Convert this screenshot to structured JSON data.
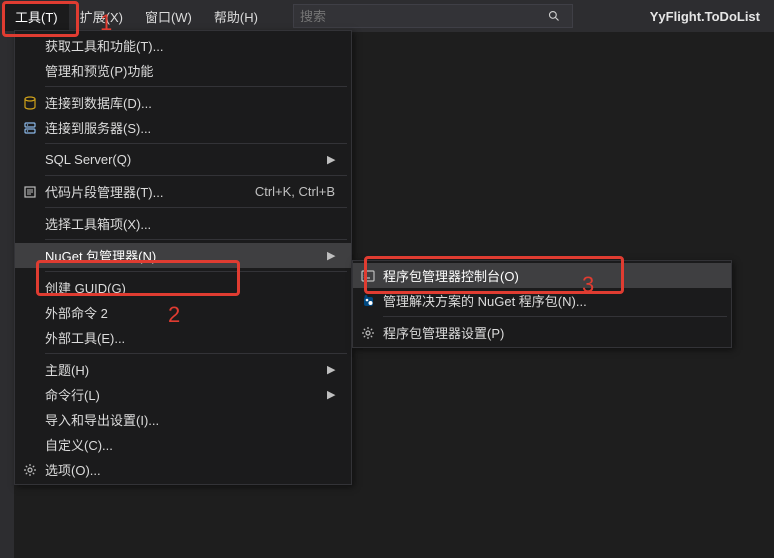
{
  "menubar": {
    "tools": "工具(T)",
    "extensions": "扩展(X)",
    "window": "窗口(W)",
    "help": "帮助(H)"
  },
  "search": {
    "placeholder": "搜索"
  },
  "solution_name": "YyFlight.ToDoList",
  "annotations": {
    "one": "1",
    "two": "2",
    "three": "3"
  },
  "tools_menu": [
    {
      "id": "get-tools",
      "label": "获取工具和功能(T)...",
      "icon": null
    },
    {
      "id": "manage-preview",
      "label": "管理和预览(P)功能",
      "icon": null
    },
    {
      "sep": true
    },
    {
      "id": "connect-db",
      "label": "连接到数据库(D)...",
      "icon": "database"
    },
    {
      "id": "connect-server",
      "label": "连接到服务器(S)...",
      "icon": "server"
    },
    {
      "sep": true
    },
    {
      "id": "sql-server",
      "label": "SQL Server(Q)",
      "icon": null,
      "submenu": true
    },
    {
      "sep": true
    },
    {
      "id": "snippet-mgr",
      "label": "代码片段管理器(T)...",
      "icon": "snippet",
      "shortcut": "Ctrl+K, Ctrl+B"
    },
    {
      "sep": true
    },
    {
      "id": "toolbox",
      "label": "选择工具箱项(X)...",
      "icon": null
    },
    {
      "sep": true
    },
    {
      "id": "nuget",
      "label": "NuGet 包管理器(N)",
      "icon": null,
      "submenu": true,
      "highlight": true
    },
    {
      "sep": true
    },
    {
      "id": "create-guid",
      "label": "创建 GUID(G)",
      "icon": null
    },
    {
      "id": "ext-cmd-2",
      "label": "外部命令 2",
      "icon": null
    },
    {
      "id": "ext-tools",
      "label": "外部工具(E)...",
      "icon": null
    },
    {
      "sep": true
    },
    {
      "id": "theme",
      "label": "主题(H)",
      "icon": null,
      "submenu": true
    },
    {
      "id": "command-line",
      "label": "命令行(L)",
      "icon": null,
      "submenu": true
    },
    {
      "id": "import-export",
      "label": "导入和导出设置(I)...",
      "icon": null
    },
    {
      "id": "customize",
      "label": "自定义(C)...",
      "icon": null
    },
    {
      "id": "options",
      "label": "选项(O)...",
      "icon": "gear"
    }
  ],
  "nuget_submenu": [
    {
      "id": "pm-console",
      "label": "程序包管理器控制台(O)",
      "icon": "console",
      "highlight": true
    },
    {
      "id": "manage-nuget",
      "label": "管理解决方案的 NuGet 程序包(N)...",
      "icon": "nuget"
    },
    {
      "sep": true
    },
    {
      "id": "pm-settings",
      "label": "程序包管理器设置(P)",
      "icon": "gear"
    }
  ]
}
